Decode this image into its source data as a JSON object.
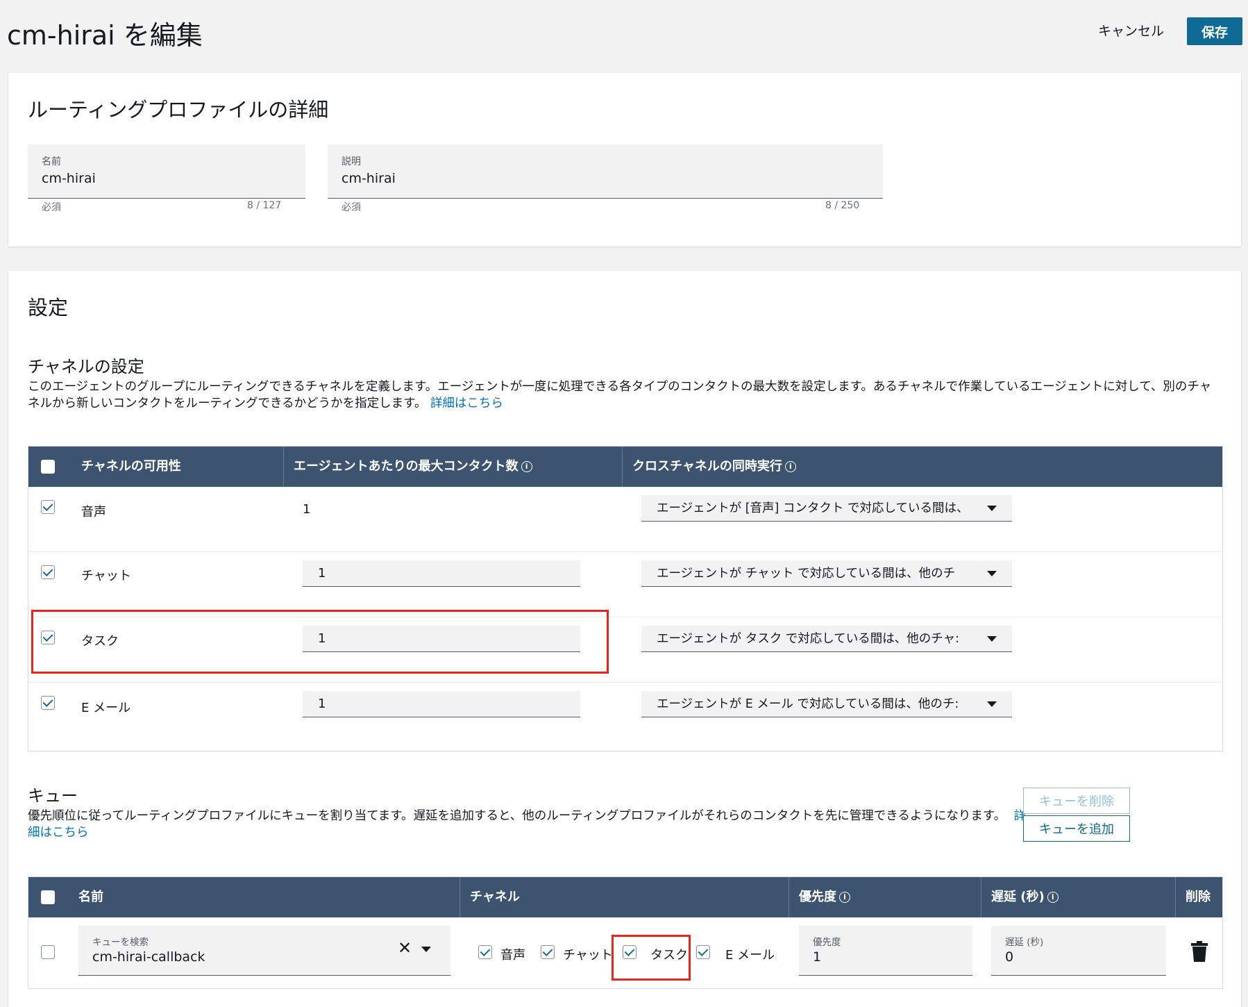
{
  "header": {
    "title": "cm-hirai を編集",
    "cancel_label": "キャンセル",
    "save_label": "保存"
  },
  "details": {
    "title": "ルーティングプロファイルの詳細",
    "name_label": "名前",
    "name_value": "cm-hirai",
    "name_hint": "必須",
    "name_count": "8 / 127",
    "desc_label": "説明",
    "desc_value": "cm-hirai",
    "desc_hint": "必須",
    "desc_count": "8 / 250"
  },
  "settings": {
    "title": "設定",
    "channel_section": {
      "title": "チャネルの設定",
      "description": "このエージェントのグループにルーティングできるチャネルを定義します。エージェントが一度に処理できる各タイプのコンタクトの最大数を設定します。あるチャネルで作業しているエージェントに対して、別のチャネルから新しいコンタクトをルーティングできるかどうかを指定します。",
      "link": "詳細はこちら",
      "columns": [
        "チャネルの可用性",
        "エージェントあたりの最大コンタクト数",
        "クロスチャネルの同時実行"
      ],
      "rows": [
        {
          "channel": "音声",
          "max_contacts": "1",
          "concurrency": "エージェントが [音声] コンタクト で対応している間は、",
          "checked": true
        },
        {
          "channel": "チャット",
          "max_contacts": "1",
          "concurrency": "エージェントが チャット で対応している間は、他のチ",
          "checked": true
        },
        {
          "channel": "タスク",
          "max_contacts": "1",
          "concurrency": "エージェントが タスク で対応している間は、他のチャ:",
          "checked": true
        },
        {
          "channel": "E メール",
          "max_contacts": "1",
          "concurrency": "エージェントが E メール で対応している間は、他のチ:",
          "checked": true
        }
      ]
    },
    "queue_section": {
      "title": "キュー",
      "description": "優先順位に従ってルーティングプロファイルにキューを割り当てます。遅延を追加すると、他のルーティングプロファイルがそれらのコンタクトを先に管理できるようになります。",
      "link": "詳細はこちら",
      "remove_label": "キューを削除",
      "add_label": "キューを追加",
      "columns": [
        "名前",
        "チャネル",
        "優先度",
        "遅延 (秒)",
        "削除"
      ],
      "row": {
        "search_label": "キューを検索",
        "search_value": "cm-hirai-callback",
        "channels": [
          {
            "label": "音声",
            "checked": true
          },
          {
            "label": "チャット",
            "checked": true
          },
          {
            "label": "タスク",
            "checked": true
          },
          {
            "label": "E メール",
            "checked": true
          }
        ],
        "priority_label": "優先度",
        "priority_value": "1",
        "delay_label": "遅延 (秒)",
        "delay_value": "0"
      }
    }
  },
  "colors": {
    "header_bg": "#3d5471",
    "primary": "#0f6b96",
    "highlight": "#e8251a"
  },
  "icons": [
    "info-icon",
    "clear-icon",
    "chevron-down-icon",
    "trash-icon",
    "checkbox-checked-icon"
  ]
}
